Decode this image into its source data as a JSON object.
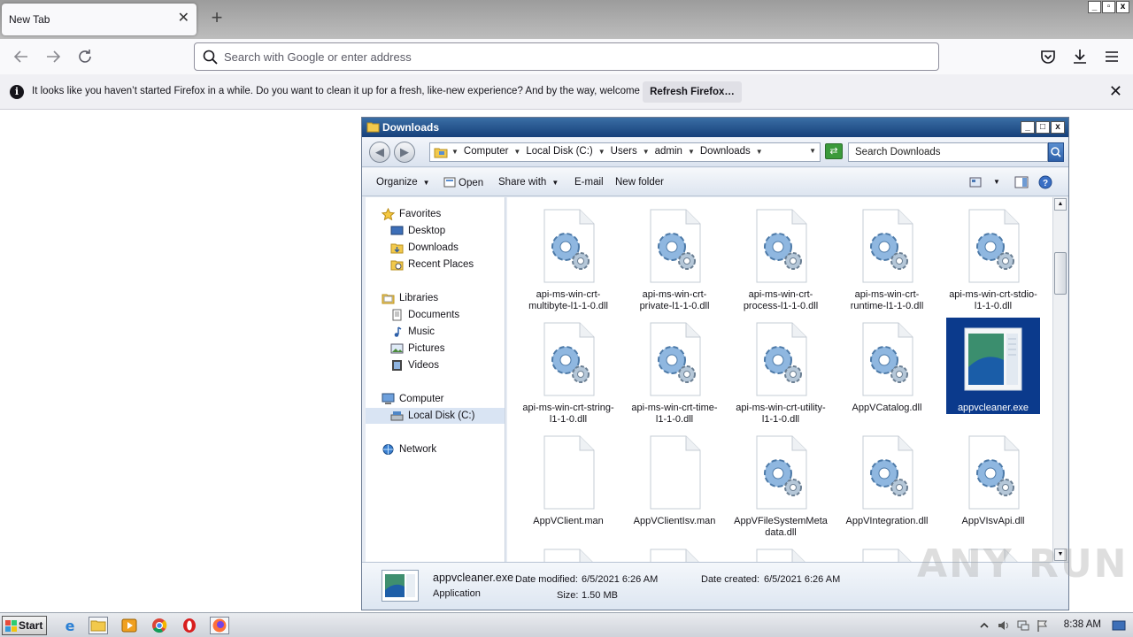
{
  "browser": {
    "tab": {
      "title": "New Tab",
      "close_glyph": "✕"
    },
    "new_tab_glyph": "+",
    "window_buttons": [
      "_",
      "▫",
      "x"
    ],
    "address_placeholder": "Search with Google or enter address",
    "nav_icons": [
      "back-icon",
      "forward-icon",
      "reload-icon"
    ],
    "toolbar_icons": [
      "pocket-icon",
      "download-icon",
      "menu-icon"
    ]
  },
  "notification": {
    "message": "It looks like you haven’t started Firefox in a while. Do you want to clean it up for a fresh, like-new experience? And by the way, welcome back!",
    "button": "Refresh Firefox…",
    "close_glyph": "✕"
  },
  "explorer": {
    "title": "Downloads",
    "breadcrumb": [
      "Computer",
      "Local Disk (C:)",
      "Users",
      "admin",
      "Downloads"
    ],
    "search_placeholder": "Search Downloads",
    "toolbar": {
      "organize": "Organize",
      "open": "Open",
      "share_with": "Share with",
      "email": "E-mail",
      "new_folder": "New folder"
    },
    "nav": {
      "favorites": "Favorites",
      "desktop": "Desktop",
      "downloads": "Downloads",
      "recent": "Recent Places",
      "libraries": "Libraries",
      "documents": "Documents",
      "music": "Music",
      "pictures": "Pictures",
      "videos": "Videos",
      "computer": "Computer",
      "local_disk": "Local Disk (C:)",
      "network": "Network"
    },
    "files": [
      {
        "name": "api-ms-win-crt-multibyte-l1-1-0.dll",
        "type": "dll"
      },
      {
        "name": "api-ms-win-crt-private-l1-1-0.dll",
        "type": "dll"
      },
      {
        "name": "api-ms-win-crt-process-l1-1-0.dll",
        "type": "dll"
      },
      {
        "name": "api-ms-win-crt-runtime-l1-1-0.dll",
        "type": "dll"
      },
      {
        "name": "api-ms-win-crt-stdio-l1-1-0.dll",
        "type": "dll"
      },
      {
        "name": "api-ms-win-crt-string-l1-1-0.dll",
        "type": "dll"
      },
      {
        "name": "api-ms-win-crt-time-l1-1-0.dll",
        "type": "dll"
      },
      {
        "name": "api-ms-win-crt-utility-l1-1-0.dll",
        "type": "dll"
      },
      {
        "name": "AppVCatalog.dll",
        "type": "dll"
      },
      {
        "name": "appvcleaner.exe",
        "type": "exe",
        "selected": true
      },
      {
        "name": "AppVClient.man",
        "type": "blank"
      },
      {
        "name": "AppVClientIsv.man",
        "type": "blank"
      },
      {
        "name": "AppVFileSystemMetadata.dll",
        "type": "dll"
      },
      {
        "name": "AppVIntegration.dll",
        "type": "dll"
      },
      {
        "name": "AppVIsvApi.dll",
        "type": "dll"
      }
    ],
    "details": {
      "name": "appvcleaner.exe",
      "type": "Application",
      "modified_label": "Date modified:",
      "modified": "6/5/2021 6:26 AM",
      "created_label": "Date created:",
      "created": "6/5/2021 6:26 AM",
      "size_label": "Size:",
      "size": "1.50 MB"
    }
  },
  "taskbar": {
    "start": "Start",
    "clock": "8:38 AM"
  },
  "watermark": "ANY RUN"
}
